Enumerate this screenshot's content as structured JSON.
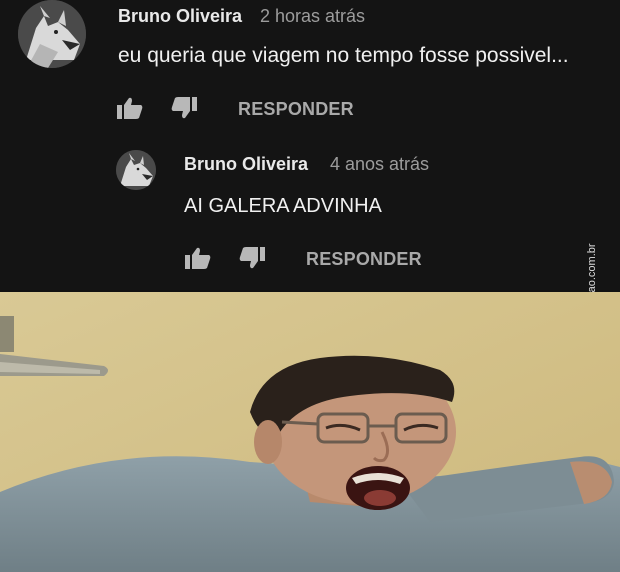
{
  "comments": [
    {
      "author": "Bruno Oliveira",
      "time": "2 horas atrás",
      "text": "eu queria que viagem no tempo fosse possivel...",
      "reply_label": "RESPONDER"
    },
    {
      "author": "Bruno Oliveira",
      "time": "4 anos atrás",
      "text": "AI GALERA ADVINHA",
      "reply_label": "RESPONDER"
    }
  ],
  "watermark": "AhNegao.com.br",
  "icons": {
    "like": "thumbs-up-icon",
    "dislike": "thumbs-down-icon"
  },
  "colors": {
    "background": "#141414",
    "author": "#e9e9e9",
    "timestamp": "#9c9c9c",
    "action": "#a9a9a9"
  }
}
